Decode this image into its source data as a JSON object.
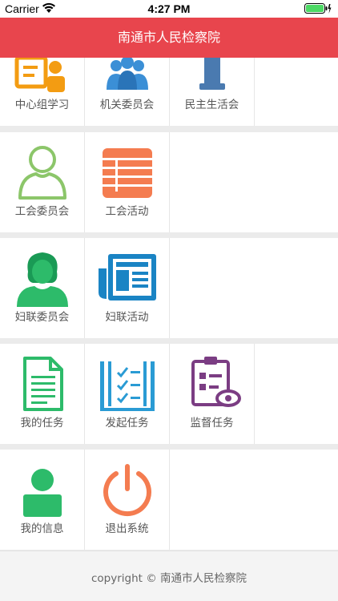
{
  "status_bar": {
    "carrier": "Carrier",
    "time": "4:27 PM"
  },
  "nav": {
    "title": "南通市人民检察院"
  },
  "sections": [
    {
      "items": [
        {
          "label": "中心组学习",
          "icon": "study-group-icon"
        },
        {
          "label": "机关委员会",
          "icon": "committee-icon"
        },
        {
          "label": "民主生活会",
          "icon": "podium-icon"
        }
      ]
    },
    {
      "items": [
        {
          "label": "工会委员会",
          "icon": "person-outline-icon"
        },
        {
          "label": "工会活动",
          "icon": "list-icon"
        }
      ]
    },
    {
      "items": [
        {
          "label": "妇联委员会",
          "icon": "woman-icon"
        },
        {
          "label": "妇联活动",
          "icon": "newspaper-icon"
        }
      ]
    },
    {
      "items": [
        {
          "label": "我的任务",
          "icon": "document-icon"
        },
        {
          "label": "发起任务",
          "icon": "checklist-book-icon"
        },
        {
          "label": "监督任务",
          "icon": "clipboard-eye-icon"
        }
      ]
    },
    {
      "items": [
        {
          "label": "我的信息",
          "icon": "user-icon"
        },
        {
          "label": "退出系统",
          "icon": "power-icon"
        }
      ]
    }
  ],
  "footer": {
    "copyright": "copyright © 南通市人民检察院"
  },
  "colors": {
    "nav_red": "#e8454d",
    "green": "#2dbb6a",
    "orange": "#f47c50",
    "blue": "#2a9bd4",
    "purple": "#7b3d83"
  }
}
